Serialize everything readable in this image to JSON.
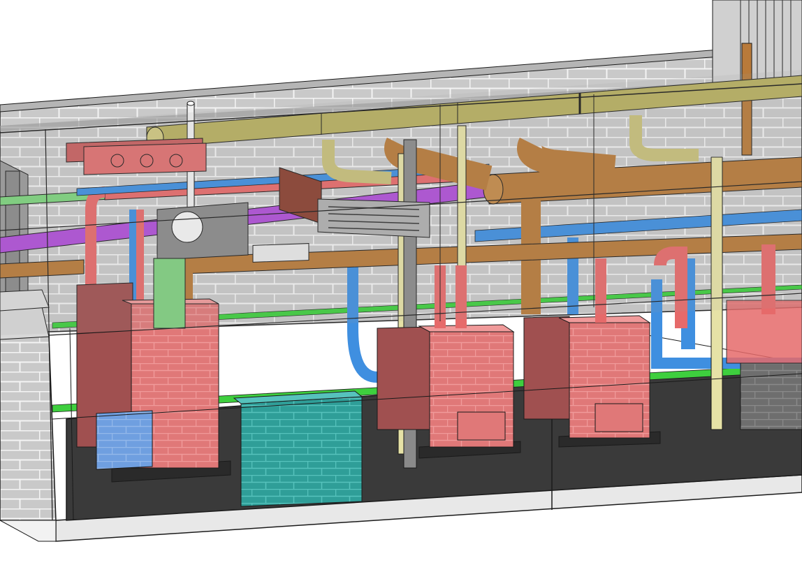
{
  "viewport": {
    "background": "#ffffff",
    "view_type": "3d-perspective",
    "render_style": "realistic-transparent-walls"
  },
  "scene": {
    "wall_color": "#c8c8c8",
    "brick_line_color": "#ffffff",
    "floor_color": "#3a3a3a",
    "outline_color": "#1a1a1a",
    "boiler_color": "#e07878",
    "boiler_count": 3,
    "tank_color": "#2f9e98",
    "panel_color": "#6f9fe0",
    "duct_color": "#a8a8a8",
    "pipe_colors": {
      "flue_olive": "#b8b060",
      "flue_brown": "#b87a3a",
      "hot_water_red": "#e66a6a",
      "chilled_water_blue": "#3f8fe0",
      "condensate_green": "#3ecf3e",
      "gas_purple": "#b04fd8",
      "vent_cream": "#e6e2a6",
      "vent_white": "#f0f0f0",
      "column_gray": "#8a8a8a"
    },
    "objects": [
      "wall-left",
      "wall-back",
      "floor",
      "trunk-flue-olive",
      "trunk-flue-brown",
      "vent-stack-left",
      "vent-stack-mid",
      "duct-silencer",
      "exhaust-fan",
      "pump-manifold",
      "boiler-1",
      "boiler-2",
      "boiler-3",
      "water-tank",
      "electrical-panel",
      "wall-outlet-box",
      "far-tower"
    ]
  }
}
